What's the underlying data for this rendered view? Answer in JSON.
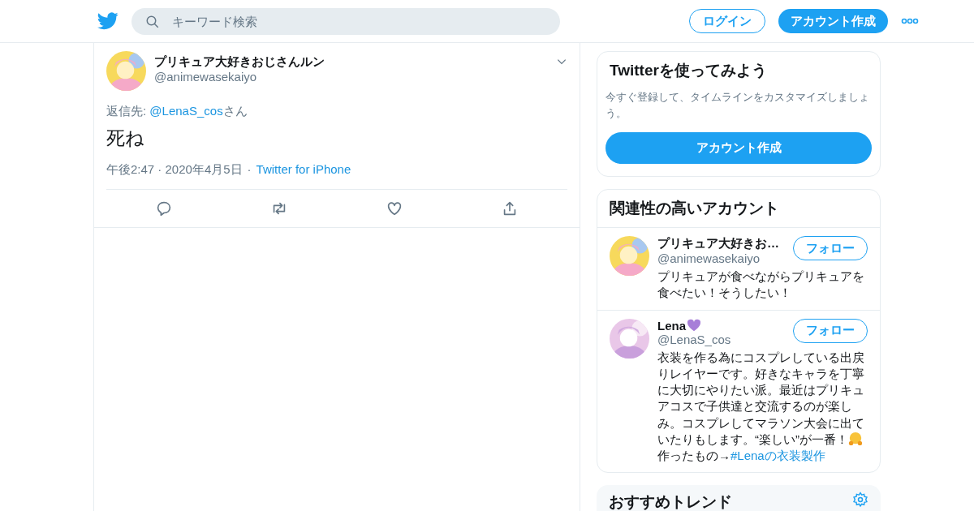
{
  "header": {
    "search": {
      "placeholder": "キーワード検索"
    },
    "login": "ログイン",
    "signup": "アカウント作成"
  },
  "tweet": {
    "name": "プリキュア大好きおじさんルン",
    "handle": "@animewasekaiyo",
    "reply_prefix": "返信先: ",
    "reply_to": "@LenaS_cos",
    "reply_suffix": "さん",
    "text": "死ね",
    "time": "午後2:47 · 2020年4月5日",
    "separator": "·",
    "source": "Twitter for iPhone"
  },
  "signup_card": {
    "title": "Twitterを使ってみよう",
    "text": "今すぐ登録して、タイムラインをカスタマイズしましょう。",
    "button": "アカウント作成"
  },
  "related": {
    "title": "関連性の高いアカウント",
    "accounts": [
      {
        "name": "プリキュア大好きお…",
        "handle": "@animewasekaiyo",
        "follow": "フォロー",
        "bio_before": "プリキュアが食べながらプリキュアを食べたい！そうしたい！",
        "emoji_heart": false,
        "emoji_in_bio": false
      },
      {
        "name": "Lena",
        "handle": "@LenaS_cos",
        "follow": "フォロー",
        "bio_before": "衣装を作る為にコスプレしている出戻りレイヤーです。好きなキャラを丁寧に大切にやりたい派。最近はプリキュアコスで子供達と交流するのが楽しみ。コスプレしてマラソン大会に出ていたりもします。“楽しい”が一番！",
        "bio_after": "作ったもの→",
        "hashtag": "#Lenaの衣装製作",
        "emoji_heart": true,
        "emoji_in_bio": true
      }
    ]
  },
  "trends": {
    "title": "おすすめトレンド"
  }
}
